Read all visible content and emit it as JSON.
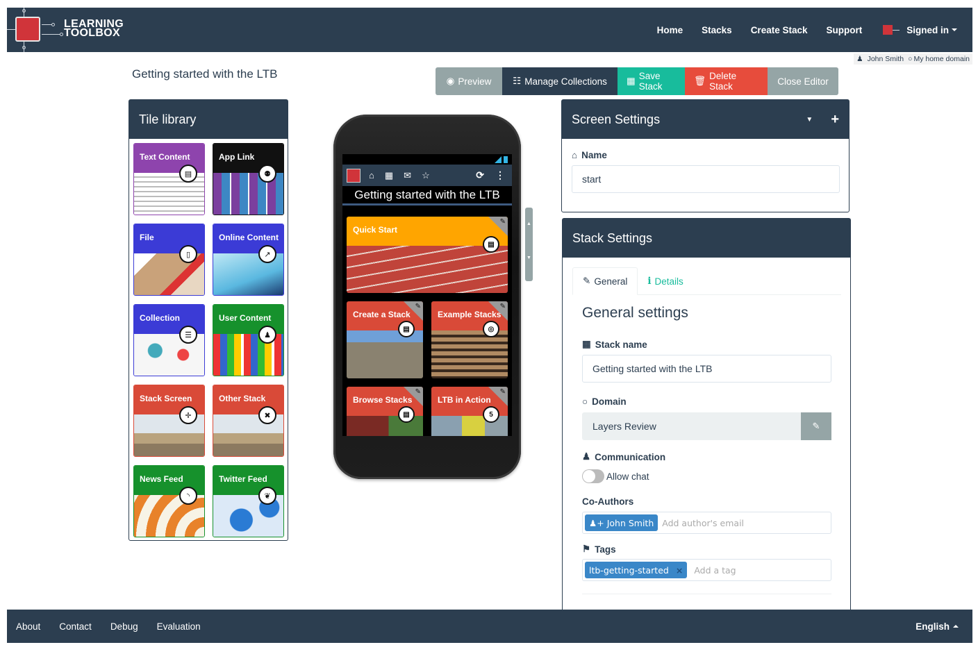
{
  "brand": {
    "line1": "LEARNING",
    "line2": "TOOLBOX"
  },
  "nav": {
    "links": [
      "Home",
      "Stacks",
      "Create Stack",
      "Support"
    ],
    "signed_in": "Signed in"
  },
  "userbar": {
    "user": "John Smith",
    "domain": "My home domain"
  },
  "page_title": "Getting started with the LTB",
  "toolbar": {
    "preview": "Preview",
    "manage": "Manage Collections",
    "save": "Save Stack",
    "delete": "Delete Stack",
    "close": "Close Editor"
  },
  "tile_library": {
    "title": "Tile library",
    "tiles": [
      {
        "label": "Text Content",
        "icon": "document-icon",
        "color": "#8e44ad"
      },
      {
        "label": "App Link",
        "icon": "android-icon",
        "color": "#111111"
      },
      {
        "label": "File",
        "icon": "file-icon",
        "color": "#3b3bd6"
      },
      {
        "label": "Online Content",
        "icon": "external-link-icon",
        "color": "#3b3bd6"
      },
      {
        "label": "Collection",
        "icon": "list-icon",
        "color": "#3b3bd6"
      },
      {
        "label": "User Content",
        "icon": "user-icon",
        "color": "#16912c"
      },
      {
        "label": "Stack Screen",
        "icon": "move-icon",
        "color": "#d94a38"
      },
      {
        "label": "Other Stack",
        "icon": "expand-icon",
        "color": "#d94a38"
      },
      {
        "label": "News Feed",
        "icon": "rss-icon",
        "color": "#16912c"
      },
      {
        "label": "Twitter Feed",
        "icon": "twitter-icon",
        "color": "#16912c"
      }
    ]
  },
  "phone": {
    "title": "Getting started with the LTB",
    "toolbar_icons": [
      "home-icon",
      "qrcode-icon",
      "envelope-icon",
      "star-icon",
      "refresh-icon",
      "more-vertical-icon"
    ],
    "tiles": [
      {
        "label": "Quick Start",
        "badge": "",
        "icon": "document-icon",
        "color": "#ffa500"
      },
      {
        "label": "Create a Stack",
        "badge": "",
        "icon": "document-icon",
        "color": "#d94a38"
      },
      {
        "label": "Example Stacks",
        "badge": "",
        "icon": "compass-icon",
        "color": "#d94a38"
      },
      {
        "label": "Browse Stacks",
        "badge": "",
        "icon": "document-icon",
        "color": "#d94a38"
      },
      {
        "label": "LTB in Action",
        "badge": "5",
        "icon": "count-badge",
        "color": "#d94a38"
      }
    ]
  },
  "screen_settings": {
    "title": "Screen Settings",
    "name_label": "Name",
    "name_value": "start"
  },
  "stack_settings": {
    "title": "Stack Settings",
    "tabs": {
      "general": "General",
      "details": "Details"
    },
    "section_title": "General settings",
    "stack_name_label": "Stack name",
    "stack_name_value": "Getting started with the LTB",
    "domain_label": "Domain",
    "domain_value": "Layers Review",
    "communication_label": "Communication",
    "allow_chat_label": "Allow chat",
    "allow_chat": false,
    "coauthors_label": "Co-Authors",
    "coauthors": [
      "John Smith"
    ],
    "coauthor_placeholder": "Add author's email",
    "tags_label": "Tags",
    "tags": [
      "ltb-getting-started"
    ],
    "tag_placeholder": "Add a tag"
  },
  "footer": {
    "links": [
      "About",
      "Contact",
      "Debug",
      "Evaluation"
    ],
    "language": "English"
  },
  "colors": {
    "navy": "#2c3e50",
    "teal": "#18bc9c",
    "red": "#e74c3c",
    "gray": "#95a5a6",
    "chip_blue": "#3a87c8"
  }
}
